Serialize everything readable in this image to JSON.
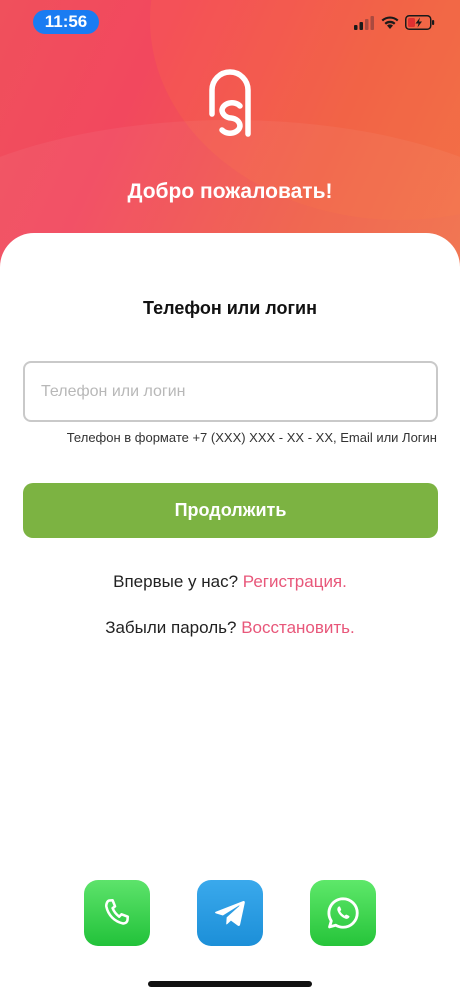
{
  "status_bar": {
    "time": "11:56",
    "icons": [
      "cellular-signal-icon",
      "wifi-icon",
      "battery-charging-icon"
    ]
  },
  "header": {
    "logo": "app-logo-icon",
    "welcome": "Добро пожаловать!"
  },
  "form": {
    "title": "Телефон или логин",
    "login_input": {
      "value": "",
      "placeholder": "Телефон или логин"
    },
    "hint": "Телефон в формате +7 (XXX) XXX - XX - XX, Email или Логин",
    "continue_label": "Продолжить"
  },
  "links": {
    "register_prompt": "Впервые у нас?",
    "register_link": "Регистрация.",
    "recover_prompt": "Забыли пароль?",
    "recover_link": "Восстановить."
  },
  "contacts": [
    {
      "name": "phone",
      "icon": "phone-icon"
    },
    {
      "name": "telegram",
      "icon": "telegram-icon"
    },
    {
      "name": "whatsapp",
      "icon": "whatsapp-icon"
    }
  ],
  "colors": {
    "header_gradient_start": "#f0505c",
    "header_gradient_end": "#f1704a",
    "primary_button": "#7cb342",
    "link": "#e8577a",
    "time_pill": "#1a7cf2"
  }
}
